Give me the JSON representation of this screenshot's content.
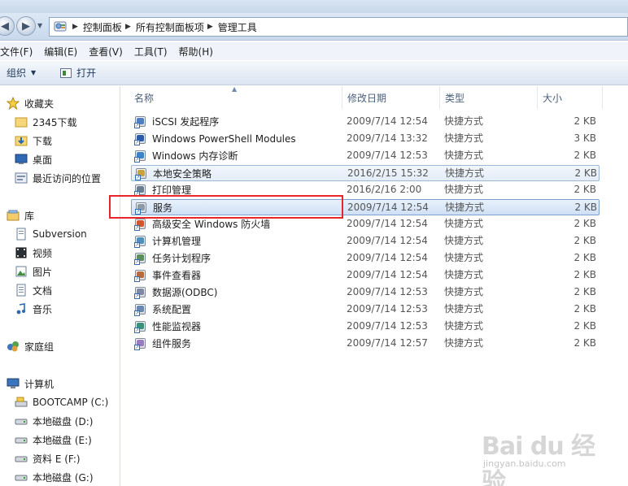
{
  "address": {
    "crumbs": [
      "控制面板",
      "所有控制面板项",
      "管理工具"
    ]
  },
  "menu": [
    "文件(F)",
    "编辑(E)",
    "查看(V)",
    "工具(T)",
    "帮助(H)"
  ],
  "toolbar": {
    "organize": "组织",
    "open": "打开"
  },
  "nav": {
    "favorites": "收藏夹",
    "favorites_items": [
      "2345下载",
      "下载",
      "桌面",
      "最近访问的位置"
    ],
    "libraries": "库",
    "library_items": [
      "Subversion",
      "视频",
      "图片",
      "文档",
      "音乐"
    ],
    "homegroup": "家庭组",
    "computer": "计算机",
    "drives": [
      "BOOTCAMP (C:)",
      "本地磁盘 (D:)",
      "本地磁盘 (E:)",
      "资料 E (F:)",
      "本地磁盘 (G:)"
    ]
  },
  "columns": {
    "name": "名称",
    "date": "修改日期",
    "type": "类型",
    "size": "大小"
  },
  "files": [
    {
      "name": "iSCSI 发起程序",
      "date": "2009/7/14 12:54",
      "type": "快捷方式",
      "size": "2 KB"
    },
    {
      "name": "Windows PowerShell Modules",
      "date": "2009/7/14 13:32",
      "type": "快捷方式",
      "size": "3 KB"
    },
    {
      "name": "Windows 内存诊断",
      "date": "2009/7/14 12:53",
      "type": "快捷方式",
      "size": "2 KB"
    },
    {
      "name": "本地安全策略",
      "date": "2016/2/15 15:32",
      "type": "快捷方式",
      "size": "2 KB"
    },
    {
      "name": "打印管理",
      "date": "2016/2/16 2:00",
      "type": "快捷方式",
      "size": "2 KB"
    },
    {
      "name": "服务",
      "date": "2009/7/14 12:54",
      "type": "快捷方式",
      "size": "2 KB"
    },
    {
      "name": "高级安全 Windows 防火墙",
      "date": "2009/7/14 12:54",
      "type": "快捷方式",
      "size": "2 KB"
    },
    {
      "name": "计算机管理",
      "date": "2009/7/14 12:54",
      "type": "快捷方式",
      "size": "2 KB"
    },
    {
      "name": "任务计划程序",
      "date": "2009/7/14 12:54",
      "type": "快捷方式",
      "size": "2 KB"
    },
    {
      "name": "事件查看器",
      "date": "2009/7/14 12:54",
      "type": "快捷方式",
      "size": "2 KB"
    },
    {
      "name": "数据源(ODBC)",
      "date": "2009/7/14 12:53",
      "type": "快捷方式",
      "size": "2 KB"
    },
    {
      "name": "系统配置",
      "date": "2009/7/14 12:53",
      "type": "快捷方式",
      "size": "2 KB"
    },
    {
      "name": "性能监视器",
      "date": "2009/7/14 12:53",
      "type": "快捷方式",
      "size": "2 KB"
    },
    {
      "name": "组件服务",
      "date": "2009/7/14 12:57",
      "type": "快捷方式",
      "size": "2 KB"
    }
  ],
  "watermark": {
    "brand": "Bai du 经验",
    "url": "jingyan.baidu.com"
  },
  "colors": {
    "highlight_box": "#e8262a",
    "selection": "#cfe0f5"
  }
}
